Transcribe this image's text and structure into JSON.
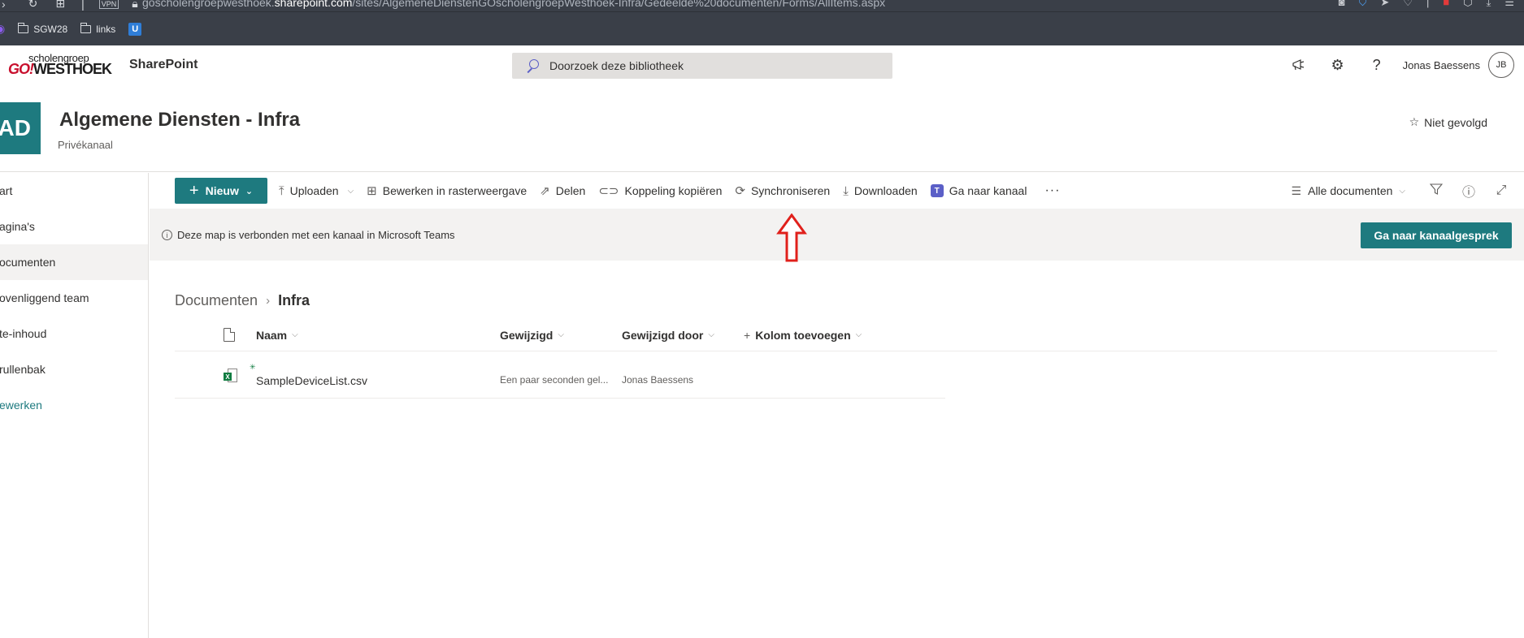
{
  "browser": {
    "url_prefix": "goscholengroepwesthoek.",
    "url_domain": "sharepoint.com",
    "url_path": "/sites/AlgemeneDienstenGOscholengroepWesthoek-Infra/Gedeelde%20documenten/Forms/AllItems.aspx",
    "vpn_label": "VPN",
    "bookmarks": [
      "SGW28",
      "links"
    ]
  },
  "suite": {
    "logo_top": "scholengroep",
    "logo_go": "GO!",
    "logo_main": "WESTHOEK",
    "app_name": "SharePoint",
    "search_placeholder": "Doorzoek deze bibliotheek",
    "user_name": "Jonas Baessens",
    "user_initials": "JB"
  },
  "site": {
    "logo_text": "AD",
    "title": "Algemene Diensten - Infra",
    "subtitle": "Privékanaal",
    "follow_label": "Niet gevolgd"
  },
  "leftnav": {
    "items": [
      {
        "label": "art"
      },
      {
        "label": "agina's"
      },
      {
        "label": "ocumenten"
      },
      {
        "label": "ovenliggend team"
      },
      {
        "label": "te-inhoud"
      },
      {
        "label": "rullenbak"
      },
      {
        "label": "ewerken"
      }
    ]
  },
  "commandbar": {
    "new_label": "Nieuw",
    "upload": "Uploaden",
    "grid_edit": "Bewerken in rasterweergave",
    "share": "Delen",
    "copy_link": "Koppeling kopiëren",
    "sync": "Synchroniseren",
    "download": "Downloaden",
    "goto_channel": "Ga naar kanaal",
    "more": "···",
    "view": "Alle documenten"
  },
  "infobar": {
    "text": "Deze map is verbonden met een kanaal in Microsoft Teams",
    "button": "Ga naar kanaalgesprek"
  },
  "breadcrumb": {
    "root": "Documenten",
    "current": "Infra"
  },
  "table": {
    "headers": {
      "name": "Naam",
      "modified": "Gewijzigd",
      "modified_by": "Gewijzigd door",
      "add_column": "Kolom toevoegen"
    },
    "rows": [
      {
        "name": "SampleDeviceList.csv",
        "modified": "Een paar seconden gel...",
        "modified_by": "Jonas Baessens"
      }
    ]
  },
  "colors": {
    "accent": "#1e7a7f",
    "annotation_arrow": "#e0201b"
  }
}
